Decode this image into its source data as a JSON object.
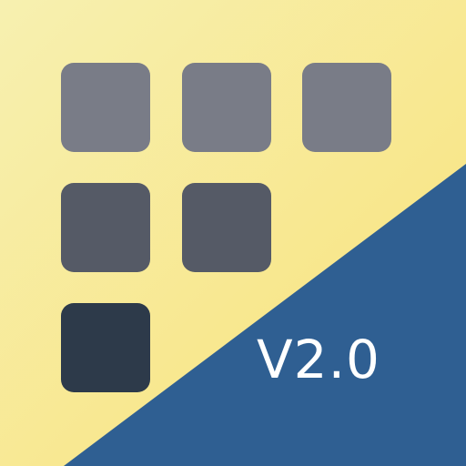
{
  "badge": {
    "version_label": "V2.0"
  },
  "colors": {
    "yellow_light": "#f7f0b0",
    "yellow": "#f8e27a",
    "blue": "#2f5f92",
    "tile_light": "#797c87",
    "tile_mid": "#555a66",
    "tile_dark": "#2d3a4a"
  },
  "grid": {
    "tiles": [
      {
        "shade": "light"
      },
      {
        "shade": "light"
      },
      {
        "shade": "light"
      },
      {
        "shade": "mid"
      },
      {
        "shade": "mid"
      },
      {
        "shade": "dark"
      }
    ]
  }
}
